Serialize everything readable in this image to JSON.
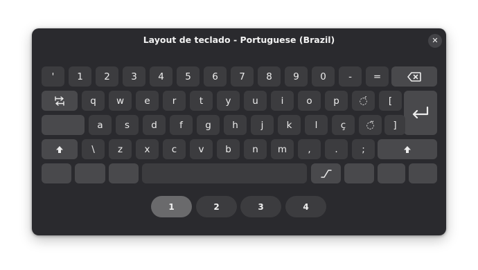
{
  "dialog": {
    "title": "Layout de teclado - Portuguese (Brazil)"
  },
  "rows": {
    "numbers": [
      "'",
      "1",
      "2",
      "3",
      "4",
      "5",
      "6",
      "7",
      "8",
      "9",
      "0",
      "-",
      "="
    ],
    "top": [
      "q",
      "w",
      "e",
      "r",
      "t",
      "y",
      "u",
      "i",
      "o",
      "p",
      "◌́",
      "["
    ],
    "home": [
      "a",
      "s",
      "d",
      "f",
      "g",
      "h",
      "j",
      "k",
      "l",
      "ç",
      "◌̃",
      "]"
    ],
    "bottom": [
      "\\",
      "z",
      "x",
      "c",
      "v",
      "b",
      "n",
      "m",
      ",",
      ".",
      ";"
    ]
  },
  "icons": {
    "close": "close-icon",
    "backspace": "backspace-icon",
    "tab": "tab-icon",
    "enter": "enter-icon",
    "shift": "shift-icon",
    "emoji": "compose-icon"
  },
  "close_glyph": "✕",
  "levels": [
    "1",
    "2",
    "3",
    "4"
  ],
  "active_level": "1"
}
